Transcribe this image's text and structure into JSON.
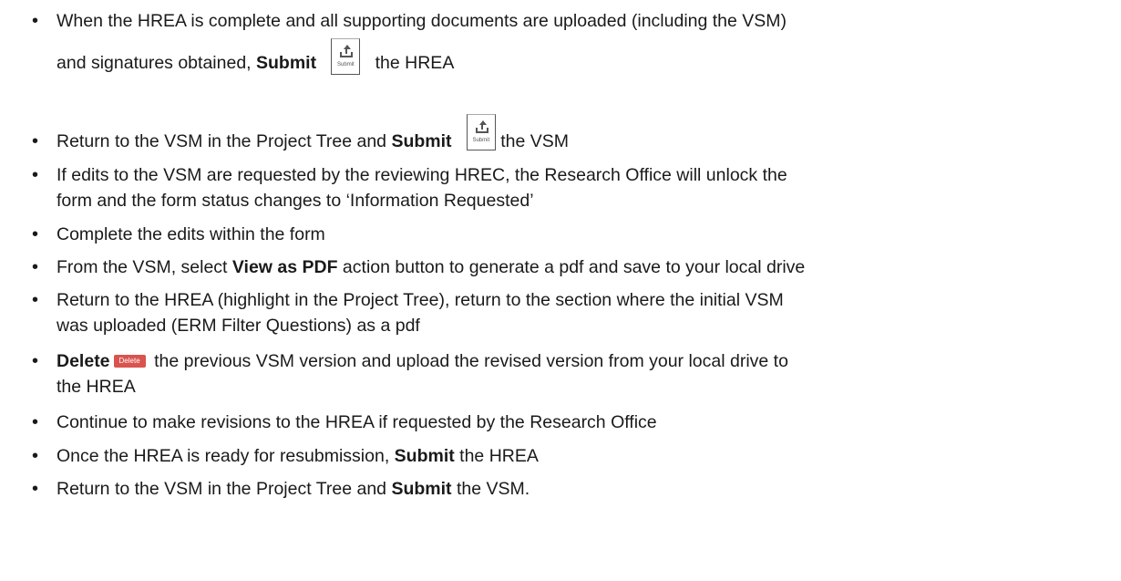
{
  "bullets": [
    {
      "line1": "When the HREA is complete and all supporting documents are uploaded (including the VSM)",
      "line2_pre": "and signatures obtained, ",
      "line2_bold": "Submit",
      "line2_post": " the HREA",
      "icon_label": "Submit"
    },
    {
      "pre": "Return to the VSM in the Project Tree and ",
      "bold": "Submit",
      "post": " the VSM",
      "icon_label": "Submit"
    },
    {
      "line1": "If edits to the VSM are requested by the reviewing HREC, the Research Office will unlock the",
      "line2": "form and the form status changes to ‘Information Requested’"
    },
    {
      "text": "Complete the edits within the form"
    },
    {
      "pre": "From the VSM, select ",
      "bold": "View as PDF",
      "post": " action button to generate a pdf and save to your local drive"
    },
    {
      "line1": "Return to the HREA (highlight in the Project Tree), return to the section where the initial VSM",
      "line2": "was uploaded (ERM Filter Questions) as a pdf"
    },
    {
      "bold": "Delete",
      "button_label": "Delete",
      "line1_post": " the previous VSM version and upload the revised version from your local drive to",
      "line2": "the HREA"
    },
    {
      "text": "Continue to make revisions to the HREA if requested by the Research Office"
    },
    {
      "pre": "Once the HREA is ready for resubmission, ",
      "bold": "Submit",
      "post": " the HREA"
    },
    {
      "pre": "Return to the VSM in the Project Tree and ",
      "bold": "Submit",
      "post": " the VSM."
    }
  ]
}
